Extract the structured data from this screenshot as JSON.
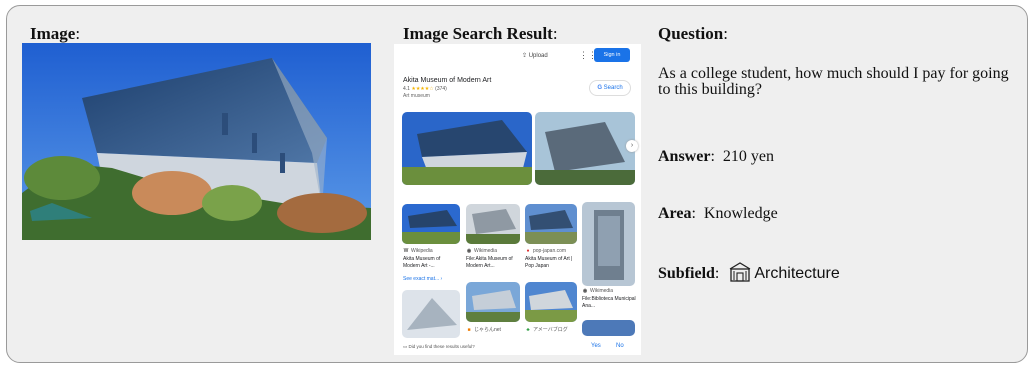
{
  "labels": {
    "image": "Image",
    "search_result": "Image Search Result",
    "question": "Question"
  },
  "question": {
    "text": "As a college student, how much should I pay for going to this building?",
    "answer_label": "Answer",
    "answer": "210 yen",
    "area_label": "Area",
    "area": "Knowledge",
    "subfield_label": "Subfield",
    "subfield": "Architecture",
    "subfield_icon": "building-icon"
  },
  "search": {
    "upload": "Upload",
    "sign_in": "Sign in",
    "kp_title": "Akita Museum of Modern Art",
    "kp_rating": "4.1",
    "kp_reviews": "(374)",
    "kp_type": "Art museum",
    "search_button": "Search",
    "results": [
      {
        "source": "Wikipedia",
        "title": "Akita Museum of Modern Art -..."
      },
      {
        "source": "Wikimedia",
        "title": "File:Akita Museum of Modern Art..."
      },
      {
        "source": "pop-japan.com",
        "title": "Akita Museum of Art | Pop Japan"
      },
      {
        "source": "Wikimedia",
        "title": "File:Biblioteca Municipal Ana..."
      },
      {
        "source": "じゃらんnet",
        "title": ""
      },
      {
        "source": "アメーバブログ",
        "title": ""
      }
    ],
    "see_exact": "See exact mat...",
    "feedback_question": "Did you find these results useful?",
    "feedback_yes": "Yes",
    "feedback_no": "No"
  },
  "colors": {
    "accent": "#1a73e8",
    "panel_bg": "#efefef",
    "panel_border": "#9a9a9a"
  }
}
